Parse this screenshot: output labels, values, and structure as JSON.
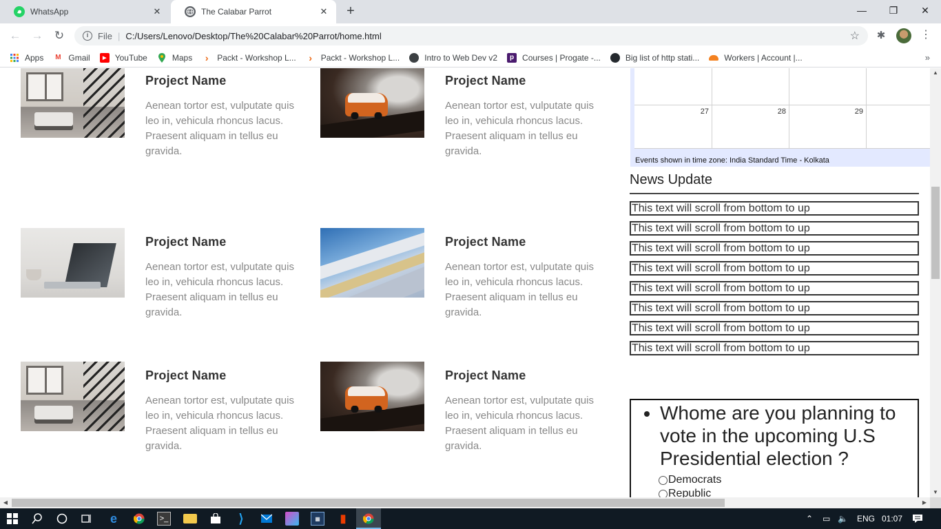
{
  "browser": {
    "tabs": [
      {
        "title": "WhatsApp",
        "active": false
      },
      {
        "title": "The Calabar Parrot",
        "active": true
      }
    ],
    "new_tab_symbol": "+",
    "close_symbol": "✕",
    "window_controls": {
      "minimize": "—",
      "maximize": "❐",
      "close": "✕"
    },
    "address": {
      "scheme_label": "File",
      "url": "C:/Users/Lenovo/Desktop/The%20Calabar%20Parrot/home.html"
    },
    "bookmarks": [
      {
        "label": "Apps",
        "icon": "apps-grid-icon"
      },
      {
        "label": "Gmail",
        "icon": "gmail-icon"
      },
      {
        "label": "YouTube",
        "icon": "youtube-icon"
      },
      {
        "label": "Maps",
        "icon": "maps-icon"
      },
      {
        "label": "Packt - Workshop L...",
        "icon": "packt-icon"
      },
      {
        "label": "Packt - Workshop L...",
        "icon": "packt-icon"
      },
      {
        "label": "Intro to Web Dev v2",
        "icon": "globe-icon"
      },
      {
        "label": "Courses | Progate -...",
        "icon": "progate-icon"
      },
      {
        "label": "Big list of http stati...",
        "icon": "github-icon"
      },
      {
        "label": "Workers | Account |...",
        "icon": "cloudflare-icon"
      }
    ],
    "bookmarks_more": "»"
  },
  "projects": [
    {
      "name": "Project Name",
      "description": "Aenean tortor est, vulputate quis leo in, vehicula rhoncus lacus. Praesent aliquam in tellus eu gravida.",
      "image": "room-photo"
    },
    {
      "name": "Project Name",
      "description": "Aenean tortor est, vulputate quis leo in, vehicula rhoncus lacus. Praesent aliquam in tellus eu gravida.",
      "image": "van-photo"
    },
    {
      "name": "Project Name",
      "description": "Aenean tortor est, vulputate quis leo in, vehicula rhoncus lacus. Praesent aliquam in tellus eu gravida.",
      "image": "laptop-photo"
    },
    {
      "name": "Project Name",
      "description": "Aenean tortor est, vulputate quis leo in, vehicula rhoncus lacus. Praesent aliquam in tellus eu gravida.",
      "image": "building-photo"
    },
    {
      "name": "Project Name",
      "description": "Aenean tortor est, vulputate quis leo in, vehicula rhoncus lacus. Praesent aliquam in tellus eu gravida.",
      "image": "room-photo"
    },
    {
      "name": "Project Name",
      "description": "Aenean tortor est, vulputate quis leo in, vehicula rhoncus lacus. Praesent aliquam in tellus eu gravida.",
      "image": "van-photo"
    }
  ],
  "calendar": {
    "visible_days": [
      "27",
      "28",
      "29"
    ],
    "timezone_note": "Events shown in time zone: India Standard Time - Kolkata"
  },
  "news": {
    "heading": "News Update",
    "items": [
      "This text will scroll from bottom to up",
      "This text will scroll from bottom to up",
      "This text will scroll from bottom to up",
      "This text will scroll from bottom to up",
      "This text will scroll from bottom to up",
      "This text will scroll from bottom to up",
      "This text will scroll from bottom to up",
      "This text will scroll from bottom to up"
    ]
  },
  "poll": {
    "question": "Whome are you planning to vote in the upcoming U.S Presidential election ?",
    "options": [
      "Democrats",
      "Republic"
    ]
  },
  "taskbar": {
    "language": "ENG",
    "time": "01:07"
  }
}
